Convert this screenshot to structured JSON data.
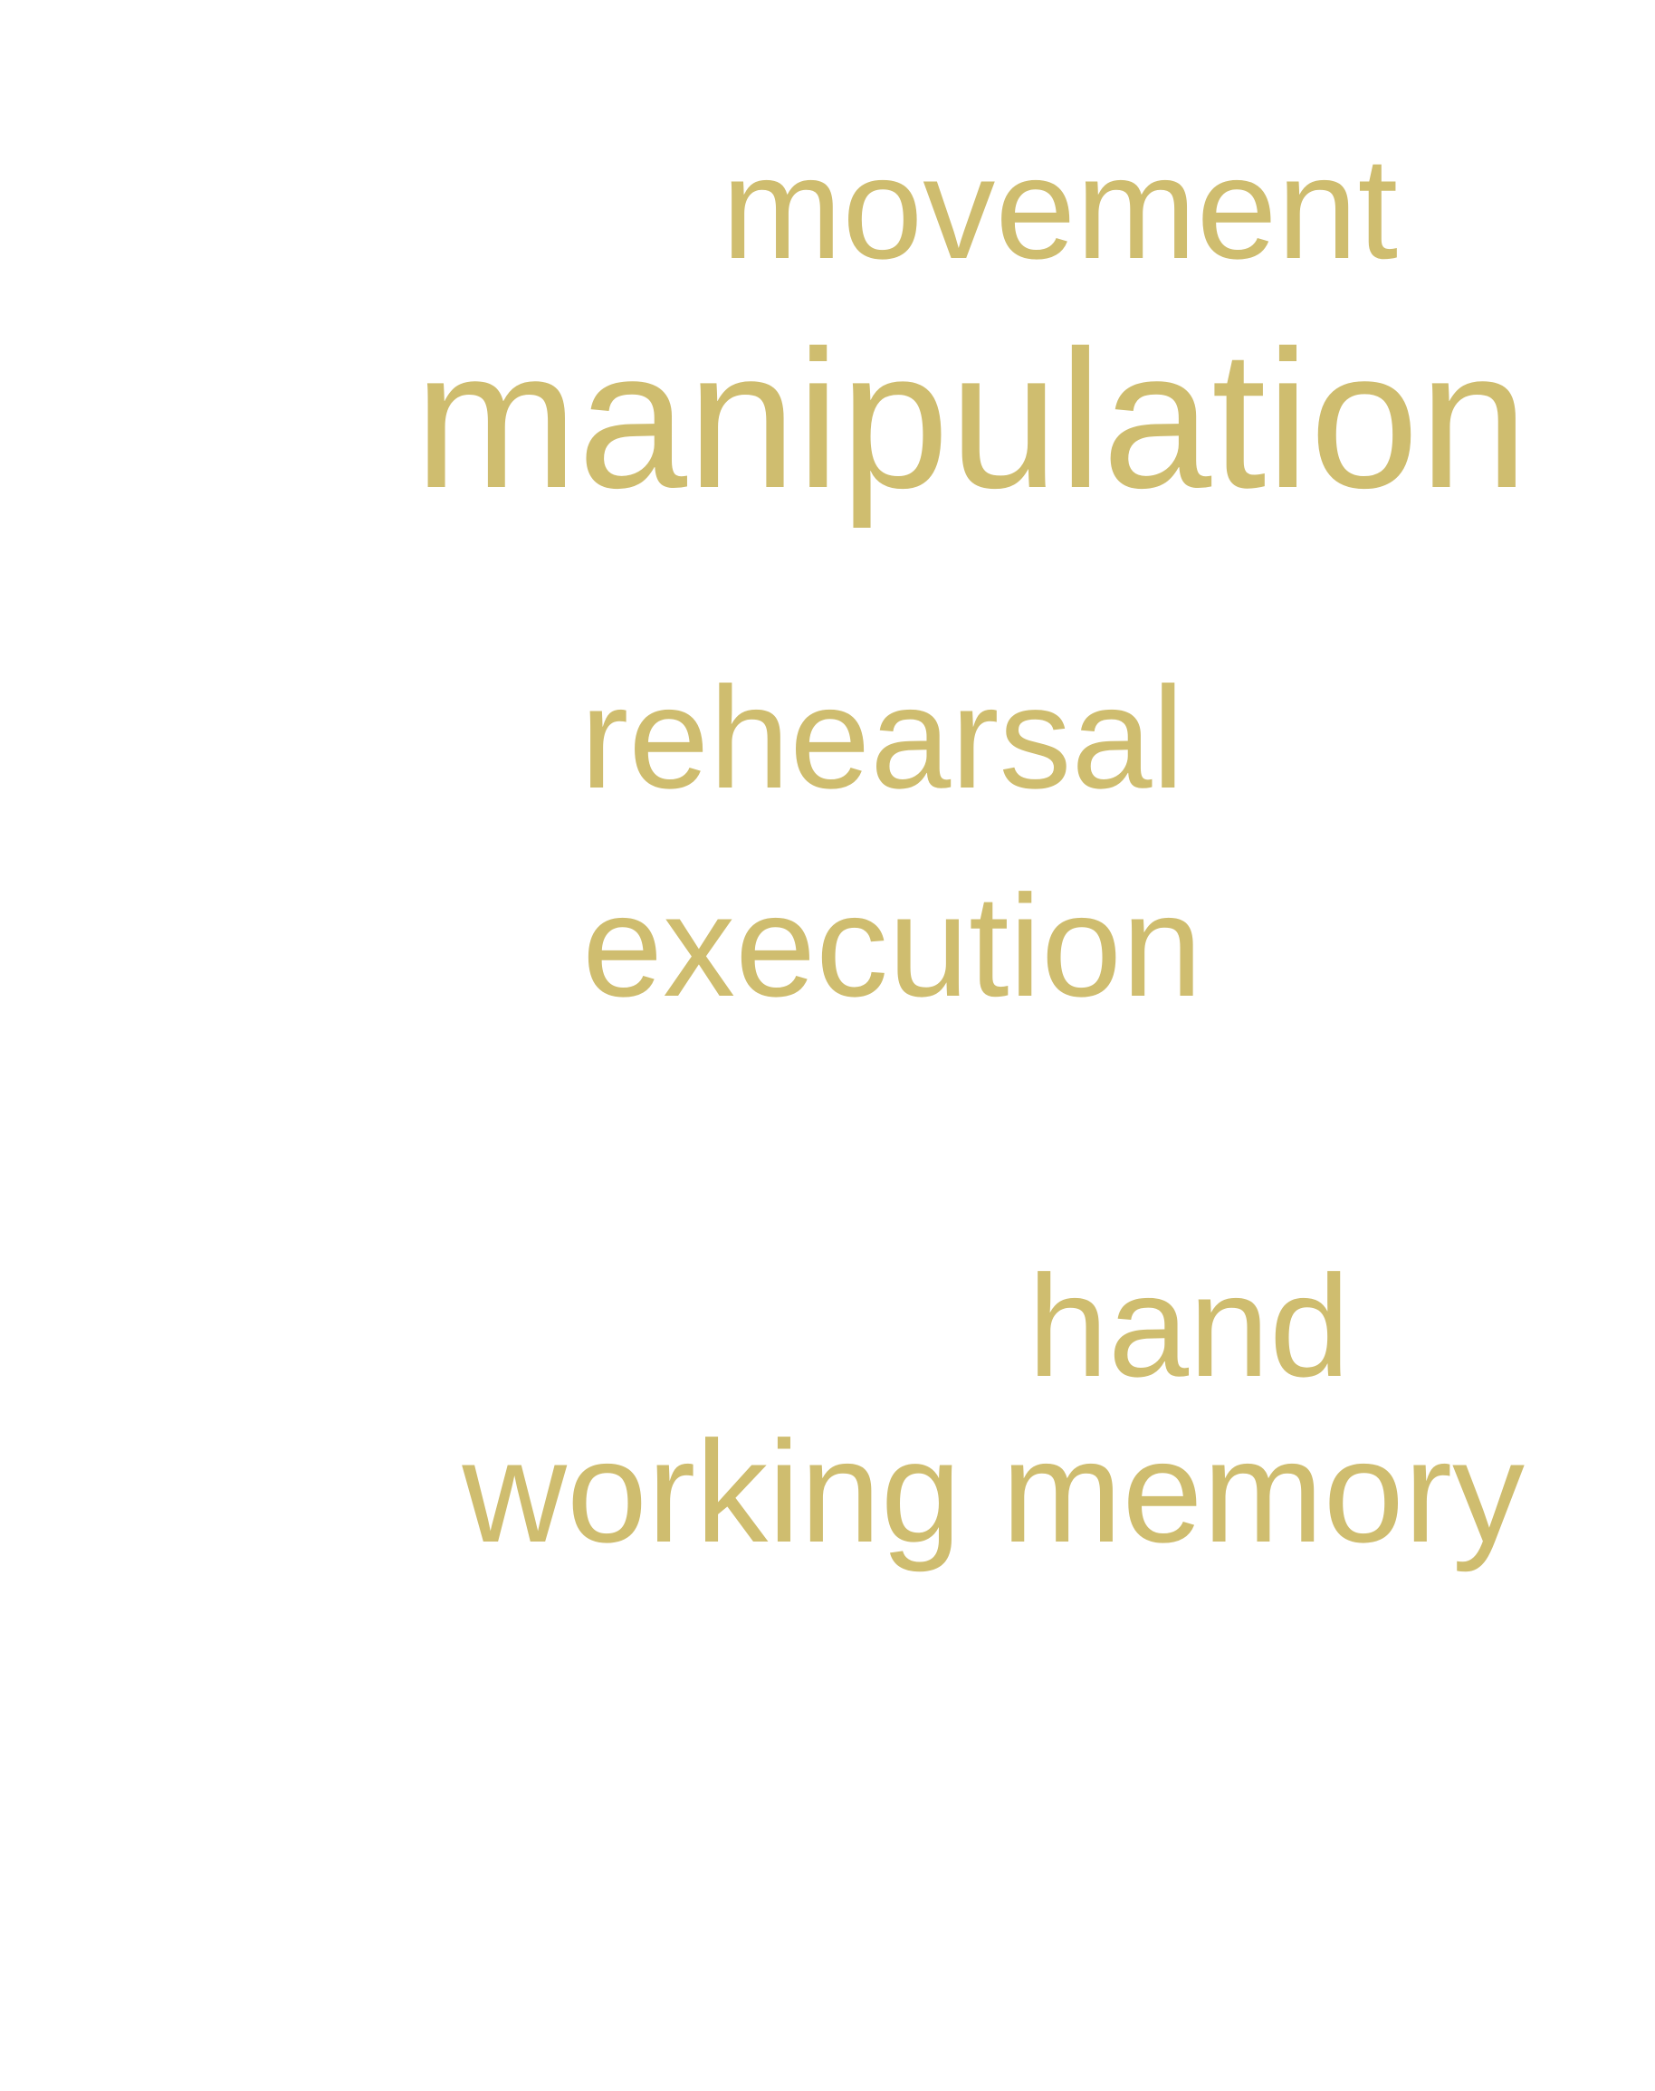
{
  "word_cloud": {
    "color": "#cfbd6f",
    "words": {
      "movement": "movement",
      "manipulation": "manipulation",
      "rehearsal": "rehearsal",
      "execution": "execution",
      "hand": "hand",
      "working_memory": "working memory"
    }
  }
}
